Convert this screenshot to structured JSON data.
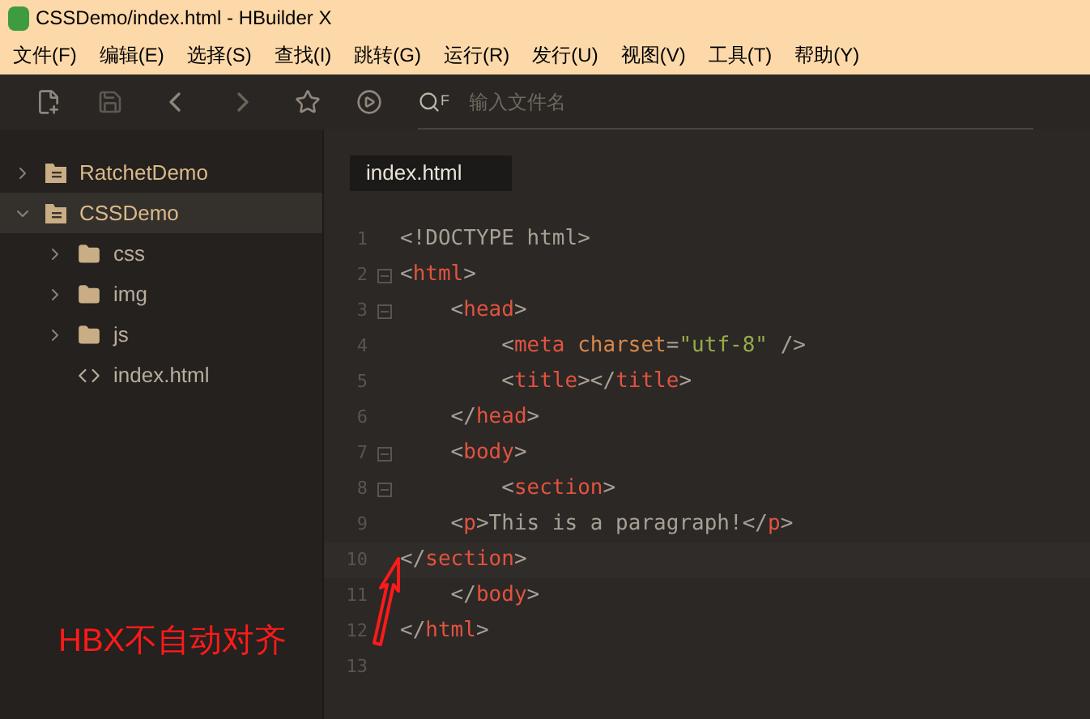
{
  "window": {
    "title": "CSSDemo/index.html - HBuilder X"
  },
  "menu": [
    "文件(F)",
    "编辑(E)",
    "选择(S)",
    "查找(I)",
    "跳转(G)",
    "运行(R)",
    "发行(U)",
    "视图(V)",
    "工具(T)",
    "帮助(Y)"
  ],
  "toolbar": {
    "search_hint": "F",
    "search": {
      "placeholder": "输入文件名"
    }
  },
  "sidebar": {
    "items": [
      {
        "label": "RatchetDemo",
        "kind": "project",
        "expanded": false,
        "selected": false
      },
      {
        "label": "CSSDemo",
        "kind": "project",
        "expanded": true,
        "selected": true,
        "children": [
          {
            "label": "css",
            "kind": "folder",
            "expanded": false,
            "selected": false
          },
          {
            "label": "img",
            "kind": "folder",
            "expanded": false,
            "selected": false
          },
          {
            "label": "js",
            "kind": "folder",
            "expanded": false,
            "selected": false
          },
          {
            "label": "index.html",
            "kind": "file",
            "selected": false
          }
        ]
      }
    ]
  },
  "tabs": [
    {
      "label": "index.html",
      "selected": true
    }
  ],
  "editor": {
    "lines": [
      {
        "number": "1",
        "fold": false,
        "current": false,
        "tokens": [
          {
            "kind": "punct",
            "text": "<!DOCTYPE html>"
          }
        ]
      },
      {
        "number": "2",
        "fold": true,
        "current": false,
        "tokens": [
          {
            "kind": "punct",
            "text": "<"
          },
          {
            "kind": "tag",
            "text": "html"
          },
          {
            "kind": "punct",
            "text": ">"
          }
        ]
      },
      {
        "number": "3",
        "fold": true,
        "current": false,
        "tokens": [
          {
            "kind": "punct",
            "text": "    <"
          },
          {
            "kind": "tag",
            "text": "head"
          },
          {
            "kind": "punct",
            "text": ">"
          }
        ]
      },
      {
        "number": "4",
        "fold": false,
        "current": false,
        "tokens": [
          {
            "kind": "punct",
            "text": "        <"
          },
          {
            "kind": "tag",
            "text": "meta"
          },
          {
            "kind": "attr",
            "text": " charset"
          },
          {
            "kind": "punct",
            "text": "="
          },
          {
            "kind": "string",
            "text": "\"utf-8\""
          },
          {
            "kind": "punct",
            "text": " />"
          }
        ]
      },
      {
        "number": "5",
        "fold": false,
        "current": false,
        "tokens": [
          {
            "kind": "punct",
            "text": "        <"
          },
          {
            "kind": "tag",
            "text": "title"
          },
          {
            "kind": "punct",
            "text": "></"
          },
          {
            "kind": "tag",
            "text": "title"
          },
          {
            "kind": "punct",
            "text": ">"
          }
        ]
      },
      {
        "number": "6",
        "fold": false,
        "current": false,
        "tokens": [
          {
            "kind": "punct",
            "text": "    </"
          },
          {
            "kind": "tag",
            "text": "head"
          },
          {
            "kind": "punct",
            "text": ">"
          }
        ]
      },
      {
        "number": "7",
        "fold": true,
        "current": false,
        "tokens": [
          {
            "kind": "punct",
            "text": "    <"
          },
          {
            "kind": "tag",
            "text": "body"
          },
          {
            "kind": "punct",
            "text": ">"
          }
        ]
      },
      {
        "number": "8",
        "fold": true,
        "current": false,
        "tokens": [
          {
            "kind": "punct",
            "text": "        <"
          },
          {
            "kind": "tag",
            "text": "section"
          },
          {
            "kind": "punct",
            "text": ">"
          }
        ]
      },
      {
        "number": "9",
        "fold": false,
        "current": false,
        "tokens": [
          {
            "kind": "punct",
            "text": "    <"
          },
          {
            "kind": "tag",
            "text": "p"
          },
          {
            "kind": "punct",
            "text": ">This is a paragraph!</"
          },
          {
            "kind": "tag",
            "text": "p"
          },
          {
            "kind": "punct",
            "text": ">"
          }
        ]
      },
      {
        "number": "10",
        "fold": false,
        "current": true,
        "tokens": [
          {
            "kind": "punct",
            "text": "</"
          },
          {
            "kind": "tag",
            "text": "section"
          },
          {
            "kind": "punct",
            "text": ">"
          }
        ]
      },
      {
        "number": "11",
        "fold": false,
        "current": false,
        "tokens": [
          {
            "kind": "punct",
            "text": "    </"
          },
          {
            "kind": "tag",
            "text": "body"
          },
          {
            "kind": "punct",
            "text": ">"
          }
        ]
      },
      {
        "number": "12",
        "fold": false,
        "current": false,
        "tokens": [
          {
            "kind": "punct",
            "text": "</"
          },
          {
            "kind": "tag",
            "text": "html"
          },
          {
            "kind": "punct",
            "text": ">"
          }
        ]
      },
      {
        "number": "13",
        "fold": false,
        "current": false
      }
    ]
  },
  "annotation": {
    "text": "HBX不自动对齐"
  }
}
